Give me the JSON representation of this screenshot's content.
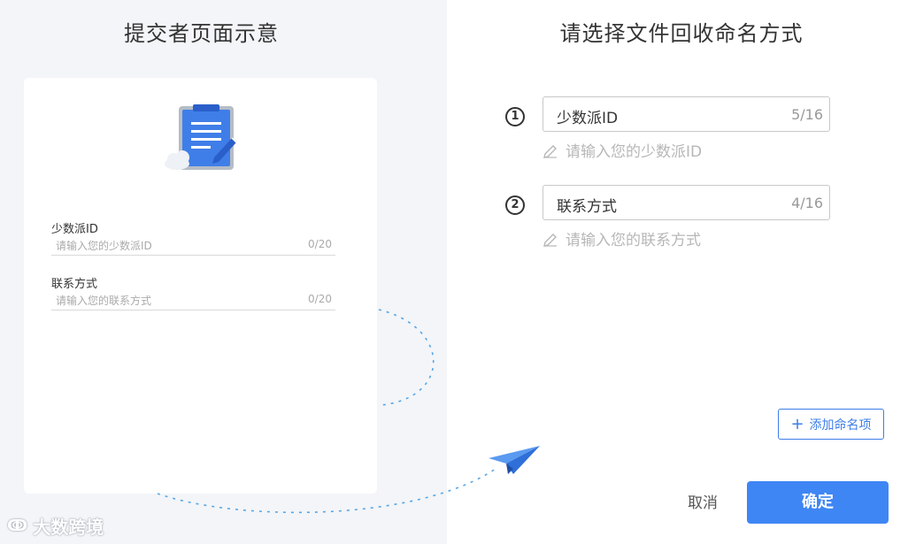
{
  "preview": {
    "title": "提交者页面示意",
    "fields": [
      {
        "label": "少数派ID",
        "placeholder": "请输入您的少数派ID",
        "count": "0/20"
      },
      {
        "label": "联系方式",
        "placeholder": "请输入您的联系方式",
        "count": "0/20"
      }
    ]
  },
  "naming": {
    "title": "请选择文件回收命名方式",
    "items": [
      {
        "number": "1",
        "value": "少数派ID",
        "count": "5/16",
        "hint": "请输入您的少数派ID"
      },
      {
        "number": "2",
        "value": "联系方式",
        "count": "4/16",
        "hint": "请输入您的联系方式"
      }
    ],
    "add_label": "添加命名项"
  },
  "actions": {
    "cancel_label": "取消",
    "confirm_label": "确定"
  },
  "watermark": {
    "text": "大数跨境"
  },
  "colors": {
    "accent": "#3f86f5",
    "panel_bg": "#f3f5f8"
  }
}
